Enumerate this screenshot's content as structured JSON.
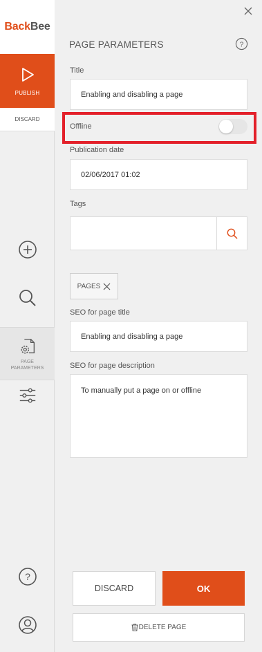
{
  "brand": {
    "part1": "Back",
    "part2": "Bee",
    "accent": "#e04e1a"
  },
  "rail": {
    "publish_label": "PUBLISH",
    "discard_label": "DISCARD",
    "page_params_label_line1": "PAGE",
    "page_params_label_line2": "PARAMETERS",
    "icons": [
      "play-icon",
      "add-circle-icon",
      "search-icon",
      "page-settings-icon",
      "sliders-icon",
      "help-icon",
      "user-icon"
    ]
  },
  "panel": {
    "title": "PAGE PARAMETERS",
    "fields": {
      "title_label": "Title",
      "title_value": "Enabling and disabling a page",
      "offline_label": "Offline",
      "offline_on": false,
      "pubdate_label": "Publication date",
      "pubdate_value": "02/06/2017 01:02",
      "tags_label": "Tags",
      "tags_value": "",
      "tag_chip": "PAGES",
      "seo_title_label": "SEO for page title",
      "seo_title_value": "Enabling and disabling a page",
      "seo_desc_label": "SEO for page description",
      "seo_desc_value": "To manually put a page on or offline"
    },
    "buttons": {
      "discard": "DISCARD",
      "ok": "OK",
      "delete": "DELETE PAGE"
    }
  },
  "highlight_color": "#e3202a"
}
